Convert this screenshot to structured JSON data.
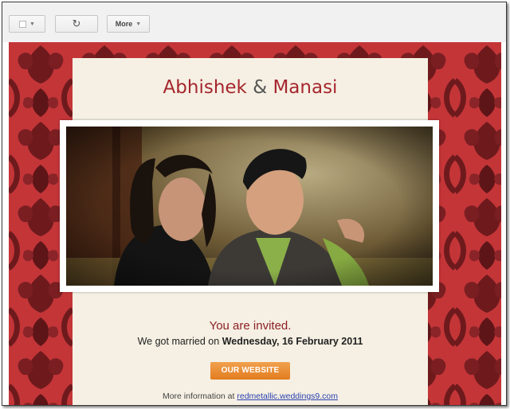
{
  "toolbar": {
    "select_icon": "checkbox-dropdown-icon",
    "refresh_icon": "refresh-icon",
    "refresh_glyph": "↻",
    "more_label": "More",
    "caret_glyph": "▼"
  },
  "invite": {
    "name_1": "Abhishek",
    "ampersand": "&",
    "name_2": "Manasi",
    "headline": "You are invited.",
    "married_prefix": "We got married on",
    "date": "Wednesday, 16 February 2011",
    "button_label": "OUR WEBSITE",
    "info_prefix": "More information at",
    "link_text": "redmetallic.weddings9.com"
  },
  "colors": {
    "pattern_bg": "#c43538",
    "card_bg": "#f5f0e3",
    "accent": "#a6262e",
    "button": "#e98b2c",
    "link": "#2a3fb0"
  }
}
